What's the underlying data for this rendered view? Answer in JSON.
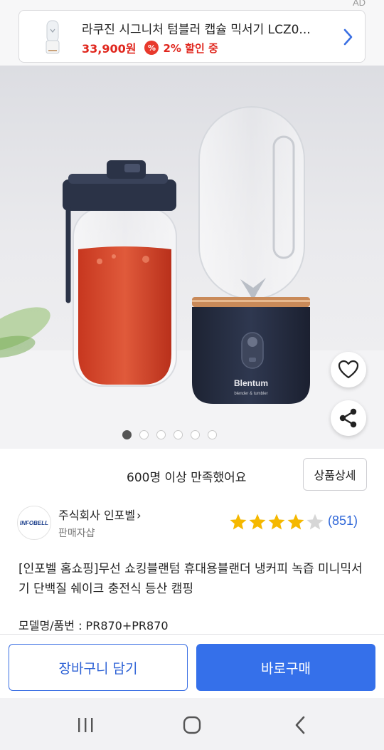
{
  "ad": {
    "tag": "AD",
    "title": "라쿠진 시그니처 텀블러 캡슐 믹서기 LCZ0...",
    "price": "33,900원",
    "badge_symbol": "%",
    "discount": "2% 할인 중",
    "colors": {
      "price": "#e0261d",
      "badge": "#e8392c",
      "chevron": "#3a6fe3"
    }
  },
  "hero": {
    "image_label": "Blentum",
    "image_sublabel": "blender & tumbler",
    "carousel": {
      "total": 6,
      "active_index": 0
    }
  },
  "satisfaction": {
    "text": "600명 이상 만족했어요",
    "detail_button": "상품상세"
  },
  "seller": {
    "logo_text": "INFOBELL",
    "name": "주식회사 인포벨",
    "chevron": "›",
    "subtitle": "판매자샵"
  },
  "rating": {
    "stars_filled": 4,
    "stars_total": 5,
    "review_count": "(851)",
    "colors": {
      "star": "#f5b800",
      "star_empty": "#d6d6d6",
      "count": "#2e66d8"
    }
  },
  "product": {
    "title": "[인포벨 홈쇼핑]무선 쇼킹블랜텀 휴대용블랜더 냉커피 녹즙 미니믹서기 단백질 쉐이크 충전식 등산 캠핑",
    "model": "모델명/품번 : PR870+PR870"
  },
  "actions": {
    "cart": "장바구니 담기",
    "buy": "바로구매",
    "colors": {
      "primary": "#3570ea"
    }
  },
  "system_nav": {
    "icons": [
      "recent-apps-icon",
      "home-icon",
      "back-icon"
    ]
  }
}
